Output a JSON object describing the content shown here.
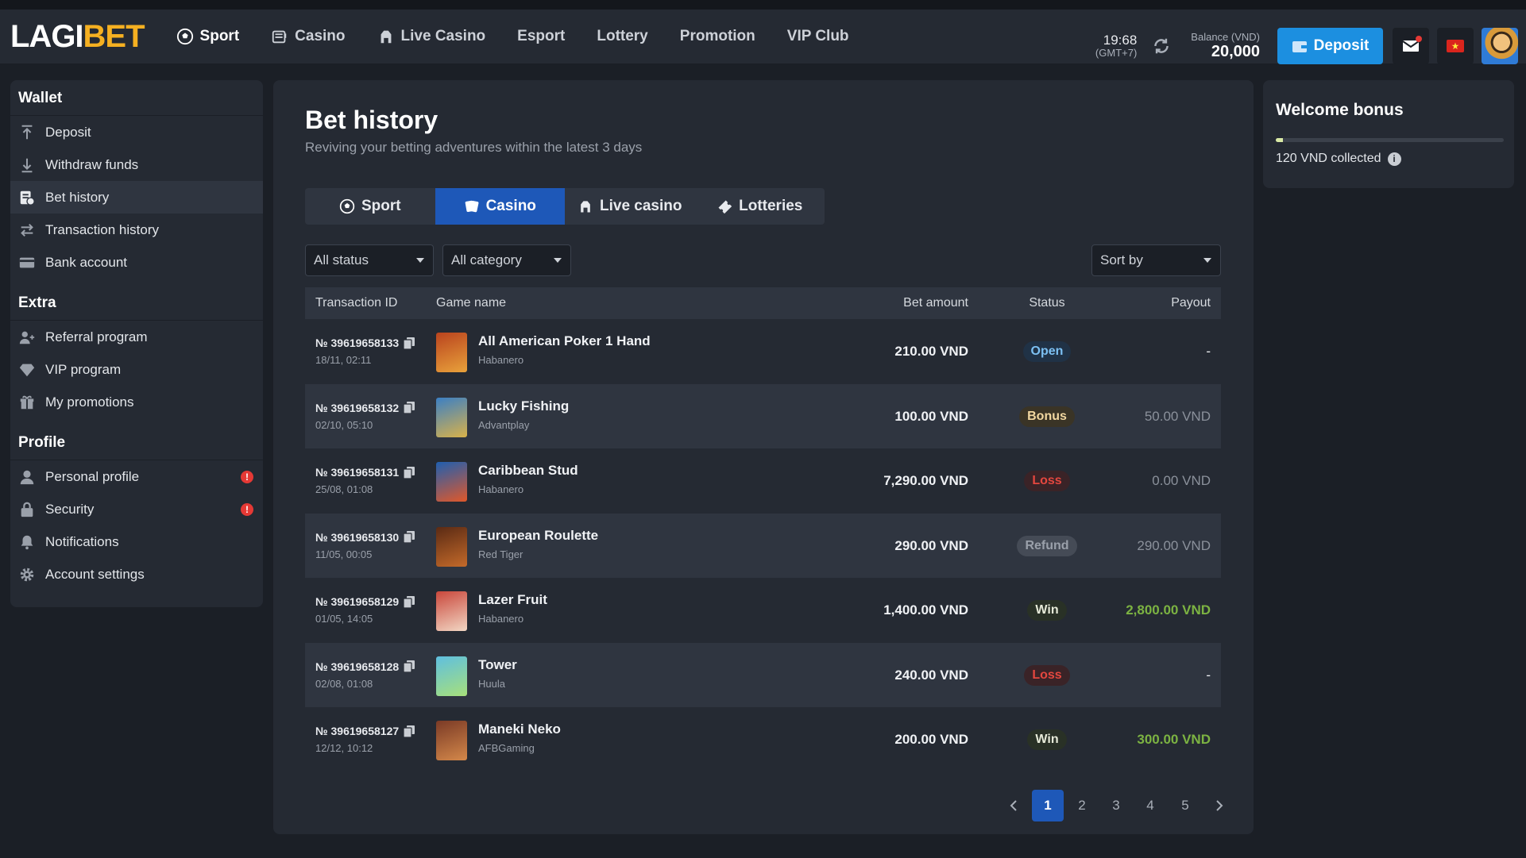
{
  "header": {
    "logo_part1": "LAGI",
    "logo_part2": "BET",
    "nav": [
      {
        "label": "Sport",
        "icon": "soccer-ball-icon"
      },
      {
        "label": "Casino",
        "icon": "slot-machine-icon"
      },
      {
        "label": "Live Casino",
        "icon": "dealer-icon"
      },
      {
        "label": "Esport",
        "icon": ""
      },
      {
        "label": "Lottery",
        "icon": ""
      },
      {
        "label": "Promotion",
        "icon": ""
      },
      {
        "label": "VIP Club",
        "icon": ""
      }
    ],
    "time": "19:68",
    "timezone": "(GMT+7)",
    "balance_label": "Balance (VND)",
    "balance_value": "20,000",
    "deposit_label": "Deposit"
  },
  "sidebar": {
    "sections": [
      {
        "title": "Wallet",
        "items": [
          {
            "label": "Deposit",
            "icon": "arrow-up-icon"
          },
          {
            "label": "Withdraw funds",
            "icon": "arrow-down-icon"
          },
          {
            "label": "Bet history",
            "icon": "bet-slip-icon",
            "active": true
          },
          {
            "label": "Transaction history",
            "icon": "swap-icon"
          },
          {
            "label": "Bank account",
            "icon": "card-icon"
          }
        ]
      },
      {
        "title": "Extra",
        "items": [
          {
            "label": "Referral program",
            "icon": "add-user-icon"
          },
          {
            "label": "VIP program",
            "icon": "diamond-icon"
          },
          {
            "label": "My promotions",
            "icon": "gift-icon"
          }
        ]
      },
      {
        "title": "Profile",
        "items": [
          {
            "label": "Personal profile",
            "icon": "user-icon",
            "alert": "!"
          },
          {
            "label": "Security",
            "icon": "lock-icon",
            "alert": "!"
          },
          {
            "label": "Notifications",
            "icon": "bell-icon"
          },
          {
            "label": "Account settings",
            "icon": "gear-icon"
          }
        ]
      }
    ]
  },
  "main": {
    "title": "Bet history",
    "subtitle": "Reviving your betting adventures within the latest 3 days",
    "tabs": [
      {
        "label": "Sport",
        "icon": "soccer-ball-icon"
      },
      {
        "label": "Casino",
        "icon": "cards-icon",
        "active": true
      },
      {
        "label": "Live casino",
        "icon": "dealer-icon"
      },
      {
        "label": "Lotteries",
        "icon": "ticket-icon"
      }
    ],
    "filters": {
      "status": "All status",
      "category": "All category",
      "sort": "Sort by"
    },
    "columns": [
      "Transaction ID",
      "Game name",
      "Bet amount",
      "Status",
      "Payout"
    ],
    "rows": [
      {
        "id": "№ 39619658133",
        "date": "18/11, 02:11",
        "game": "All American Poker 1 Hand",
        "provider": "Habanero",
        "amount": "210.00 VND",
        "status": "Open",
        "payout": "-",
        "thumb": [
          "#b9431e",
          "#e9a23b"
        ]
      },
      {
        "id": "№ 39619658132",
        "date": "02/10, 05:10",
        "game": "Lucky Fishing",
        "provider": "Advantplay",
        "amount": "100.00 VND",
        "status": "Bonus",
        "payout": "50.00 VND",
        "thumb": [
          "#3b7fc4",
          "#d9b24a"
        ]
      },
      {
        "id": "№ 39619658131",
        "date": "25/08, 01:08",
        "game": "Caribbean Stud",
        "provider": "Habanero",
        "amount": "7,290.00 VND",
        "status": "Loss",
        "payout": "0.00 VND",
        "thumb": [
          "#1f5fb0",
          "#e0582a"
        ]
      },
      {
        "id": "№ 39619658130",
        "date": "11/05, 00:05",
        "game": "European Roulette",
        "provider": "Red Tiger",
        "amount": "290.00 VND",
        "status": "Refund",
        "payout": "290.00 VND",
        "thumb": [
          "#5a2a14",
          "#c46a2a"
        ]
      },
      {
        "id": "№ 39619658129",
        "date": "01/05, 14:05",
        "game": "Lazer Fruit",
        "provider": "Habanero",
        "amount": "1,400.00 VND",
        "status": "Win",
        "payout": "2,800.00 VND",
        "thumb": [
          "#c9473b",
          "#f2d7c4"
        ]
      },
      {
        "id": "№ 39619658128",
        "date": "02/08, 01:08",
        "game": "Tower",
        "provider": "Huula",
        "amount": "240.00 VND",
        "status": "Loss",
        "payout": "-",
        "thumb": [
          "#5fbfe0",
          "#a7e07a"
        ]
      },
      {
        "id": "№ 39619658127",
        "date": "12/12, 10:12",
        "game": "Maneki Neko",
        "provider": "AFBGaming",
        "amount": "200.00 VND",
        "status": "Win",
        "payout": "300.00 VND",
        "thumb": [
          "#7a3a26",
          "#d4884a"
        ]
      }
    ],
    "pagination": {
      "pages": [
        "1",
        "2",
        "3",
        "4",
        "5"
      ],
      "current": "1"
    }
  },
  "welcome_bonus": {
    "title": "Welcome bonus",
    "collected": "120 VND collected",
    "progress": 0.03
  },
  "colors": {
    "accent": "#1c8fe0",
    "tab_active": "#1e58b8",
    "brand": "#f5b021",
    "win": "#7cb342",
    "loss": "#e4473f"
  }
}
